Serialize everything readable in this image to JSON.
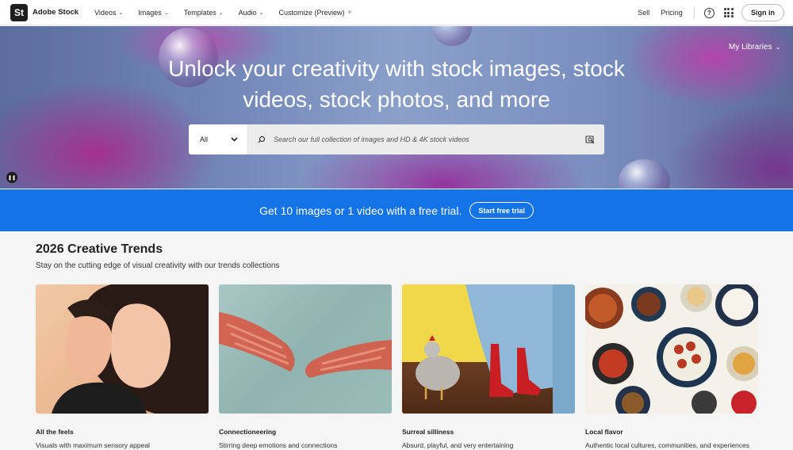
{
  "header": {
    "logo_mark": "St",
    "logo_text": "Adobe Stock",
    "nav": [
      {
        "label": "Videos"
      },
      {
        "label": "Images"
      },
      {
        "label": "Templates"
      },
      {
        "label": "Audio"
      },
      {
        "label": "Customize (Preview)"
      }
    ],
    "sell": "Sell",
    "pricing": "Pricing",
    "sign_in": "Sign in"
  },
  "hero": {
    "title_line1": "Unlock your creativity with stock images, stock",
    "title_line2": "videos, stock photos, and more",
    "my_libraries": "My Libraries",
    "search_type": "All",
    "search_placeholder": "Search our full collection of images and HD & 4K stock videos"
  },
  "promo": {
    "text": "Get 10 images or 1 video with a free trial.",
    "button": "Start free trial"
  },
  "trends": {
    "heading": "2026 Creative Trends",
    "subheading": "Stay on the cutting edge of visual creativity with our trends collections",
    "cards": [
      {
        "title": "All the feels",
        "desc": "Visuals with maximum sensory appeal"
      },
      {
        "title": "Connectioneering",
        "desc": "Stirring deep emotions and connections"
      },
      {
        "title": "Surreal silliness",
        "desc": "Absurd, playful, and very entertaining"
      },
      {
        "title": "Local flavor",
        "desc": "Authentic local cultures, communities, and experiences"
      }
    ]
  },
  "colors": {
    "promo_blue": "#1473e6",
    "accent_red": "#c8222a"
  }
}
